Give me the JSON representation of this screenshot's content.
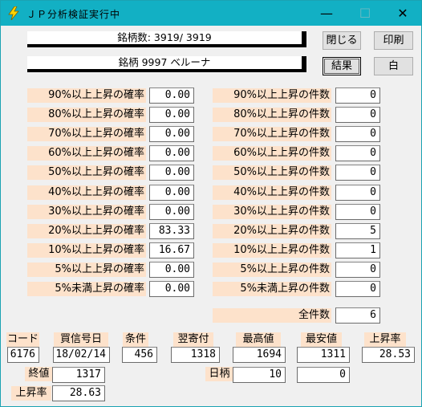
{
  "window": {
    "title": "ＪＰ分析検証実行中",
    "minimize": "—",
    "maximize": "☐",
    "close": "✕"
  },
  "status": {
    "count_text": "銘柄数: 3919/ 3919",
    "stock_text": "銘柄 9997 ベルーナ"
  },
  "buttons": {
    "close": "閉じる",
    "print": "印刷",
    "result": "結果",
    "white": "白"
  },
  "probabilities": [
    {
      "label": "90%以上上昇の確率",
      "value": "0.00"
    },
    {
      "label": "80%以上上昇の確率",
      "value": "0.00"
    },
    {
      "label": "70%以上上昇の確率",
      "value": "0.00"
    },
    {
      "label": "60%以上上昇の確率",
      "value": "0.00"
    },
    {
      "label": "50%以上上昇の確率",
      "value": "0.00"
    },
    {
      "label": "40%以上上昇の確率",
      "value": "0.00"
    },
    {
      "label": "30%以上上昇の確率",
      "value": "0.00"
    },
    {
      "label": "20%以上上昇の確率",
      "value": "83.33"
    },
    {
      "label": "10%以上上昇の確率",
      "value": "16.67"
    },
    {
      "label": "5%以上上昇の確率",
      "value": "0.00"
    },
    {
      "label": "5%未満上昇の確率",
      "value": "0.00"
    }
  ],
  "counts": [
    {
      "label": "90%以上上昇の件数",
      "value": "0"
    },
    {
      "label": "80%以上上昇の件数",
      "value": "0"
    },
    {
      "label": "70%以上上昇の件数",
      "value": "0"
    },
    {
      "label": "60%以上上昇の件数",
      "value": "0"
    },
    {
      "label": "50%以上上昇の件数",
      "value": "0"
    },
    {
      "label": "40%以上上昇の件数",
      "value": "0"
    },
    {
      "label": "30%以上上昇の件数",
      "value": "0"
    },
    {
      "label": "20%以上上昇の件数",
      "value": "5"
    },
    {
      "label": "10%以上上昇の件数",
      "value": "1"
    },
    {
      "label": "5%以上上昇の件数",
      "value": "0"
    },
    {
      "label": "5%未満上昇の件数",
      "value": "0"
    }
  ],
  "total": {
    "label": "全件数",
    "value": "6"
  },
  "detail": {
    "code": {
      "label": "コード",
      "value": "6176"
    },
    "buy_date": {
      "label": "買信号日",
      "value": "18/02/14"
    },
    "condition": {
      "label": "条件",
      "value": "456"
    },
    "next_open": {
      "label": "翌寄付",
      "value": "1318"
    },
    "high": {
      "label": "最高値",
      "value": "1694"
    },
    "low": {
      "label": "最安値",
      "value": "1311"
    },
    "rise": {
      "label": "上昇率",
      "value": "28.53"
    },
    "close_price": {
      "label": "終値",
      "value": "1317"
    },
    "days": {
      "label": "日柄",
      "value": "10"
    },
    "extra": {
      "value": "0"
    },
    "rise2": {
      "label": "上昇率",
      "value": "28.63"
    }
  },
  "colors": {
    "titlebar": "#12b0c4",
    "label_bg": "#fde2cb",
    "window_bg": "#f0f0f0"
  }
}
